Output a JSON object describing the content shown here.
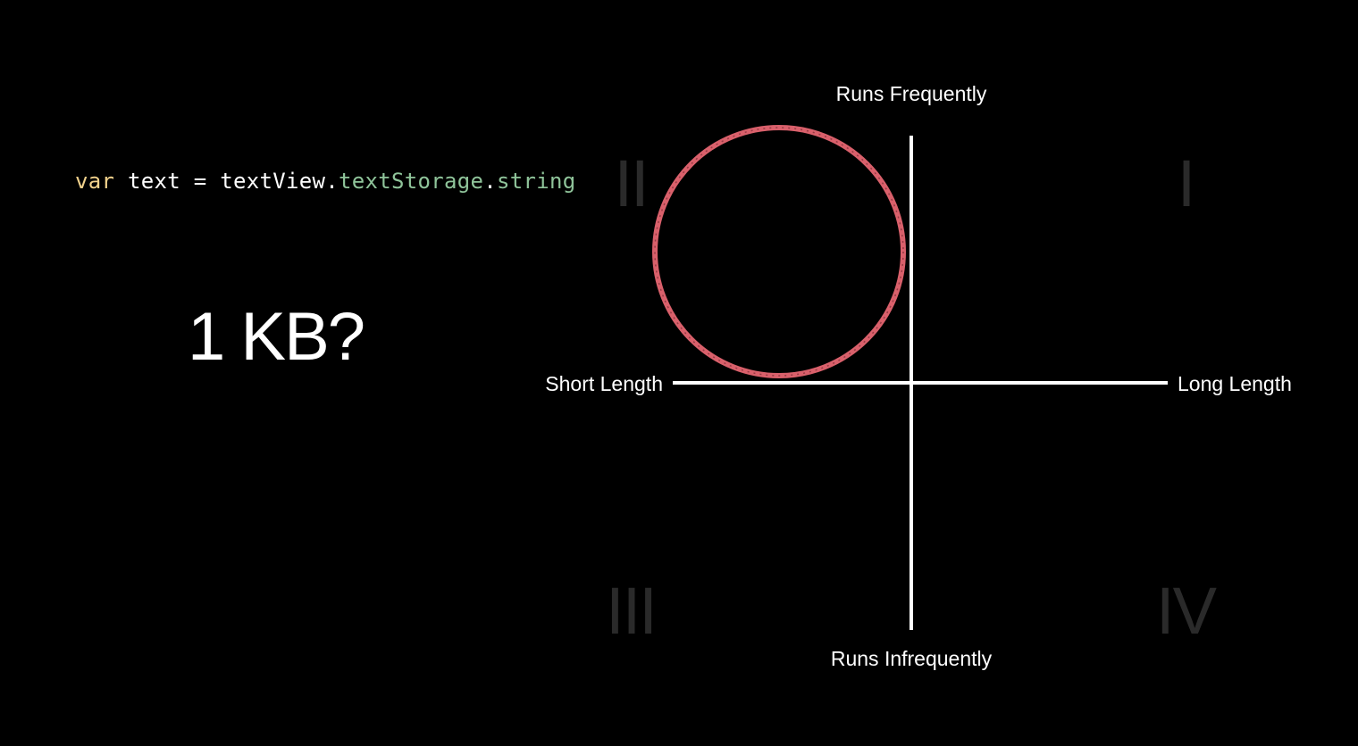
{
  "code": {
    "keyword": "var",
    "name": " text = textView.",
    "prop1": "textStorage",
    "dot": ".",
    "prop2": "string"
  },
  "size_question": "1 KB?",
  "axes": {
    "top": "Runs Frequently",
    "bottom": "Runs Infrequently",
    "left": "Short Length",
    "right": "Long Length"
  },
  "quadrants": {
    "q1": "I",
    "q2": "II",
    "q3": "III",
    "q4": "IV"
  },
  "highlight": {
    "quadrant": "II",
    "color": "#d9606b"
  },
  "colors": {
    "background": "#000000",
    "axis": "#ffffff",
    "keyword": "#f2d28c",
    "property": "#8fc49a",
    "numeral": "#2a2a2a"
  }
}
